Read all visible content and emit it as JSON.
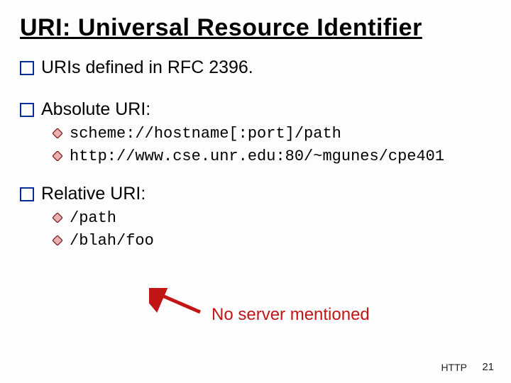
{
  "title": "URI: Universal Resource Identifier",
  "points": {
    "p1": "URIs defined in RFC 2396.",
    "p2": "Absolute URI:",
    "p2_sub": [
      "scheme://hostname[:port]/path",
      "http://www.cse.unr.edu:80/~mgunes/cpe401"
    ],
    "p3": "Relative URI:",
    "p3_sub": [
      "/path",
      "/blah/foo"
    ]
  },
  "annotation": "No server mentioned",
  "footer": {
    "topic": "HTTP",
    "page": "21"
  },
  "colors": {
    "bullet_border": "#002d9a",
    "diamond_stroke": "#7a0f0f",
    "diamond_fill": "#e8b0b0",
    "arrow": "#c21616",
    "note": "#c21616"
  }
}
